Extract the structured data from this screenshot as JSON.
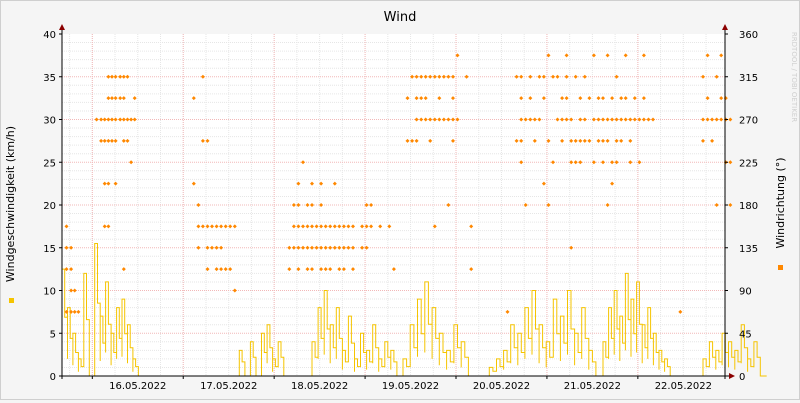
{
  "chart_data": {
    "type": "scatter",
    "title": "Wind",
    "watermark": "RRDTOOL / TOBI OETIKER",
    "ylabel_left": "Windgeschwindigkeit (km/h)",
    "ylabel_right": "Windrichtung (°)",
    "y_left_range": [
      0,
      40
    ],
    "y_right_range": [
      0,
      360
    ],
    "y_left_ticks": [
      "0",
      "5",
      "10",
      "15",
      "20",
      "25",
      "30",
      "35",
      "40"
    ],
    "y_right_ticks": [
      "0",
      "45",
      "90",
      "135",
      "180",
      "225",
      "270",
      "315",
      "360"
    ],
    "x_range": [
      "15.05.2022 16:00",
      "22.05.2022 23:00"
    ],
    "x_ticks": [
      "16.05.2022",
      "17.05.2022",
      "18.05.2022",
      "19.05.2022",
      "20.05.2022",
      "21.05.2022",
      "22.05.2022"
    ],
    "grid": true,
    "colors": {
      "speed": "#f5c400",
      "direction": "#ff8800",
      "grid_major": "#f2b8b8",
      "grid_minor": "#e6e6e6",
      "axis": "#8b0000"
    },
    "series": [
      {
        "name": "",
        "axis": "left",
        "kind": "step-line",
        "segments": [
          {
            "start_day": 0.0,
            "end_day": 0.9,
            "peaks": [
              12.5,
              8,
              5,
              2,
              12,
              0,
              15.5,
              7,
              11,
              5,
              8,
              9,
              6,
              2,
              0
            ]
          },
          {
            "start_day": 1.95,
            "end_day": 2.5,
            "peaks": [
              3,
              0,
              4,
              0,
              5,
              6,
              2,
              4,
              0
            ]
          },
          {
            "start_day": 2.75,
            "end_day": 3.75,
            "peaks": [
              4,
              8,
              10,
              6,
              8,
              3,
              7,
              2,
              5,
              3,
              6,
              2,
              4,
              3,
              0
            ]
          },
          {
            "start_day": 3.75,
            "end_day": 4.55,
            "peaks": [
              2,
              6,
              9,
              11,
              8,
              5,
              3,
              6,
              4,
              0
            ]
          },
          {
            "start_day": 4.7,
            "end_day": 5.95,
            "peaks": [
              1,
              2,
              3,
              6,
              5,
              8,
              10,
              6,
              4,
              9,
              7,
              10,
              5,
              8,
              3,
              0
            ]
          },
          {
            "start_day": 5.95,
            "end_day": 6.75,
            "peaks": [
              4,
              8,
              10,
              7,
              12,
              9,
              11,
              6,
              8,
              5,
              3,
              2,
              0
            ]
          },
          {
            "start_day": 7.05,
            "end_day": 7.75,
            "peaks": [
              2,
              4,
              3,
              5,
              4,
              3,
              6,
              2,
              4,
              0
            ]
          }
        ]
      },
      {
        "name": "",
        "axis": "right",
        "kind": "points",
        "columns": [
          [
            0.05,
            [
              67.5,
              112.5,
              135,
              157.5
            ]
          ],
          [
            0.1,
            [
              67.5,
              90,
              112.5,
              135
            ]
          ],
          [
            0.14,
            [
              67.5,
              90
            ]
          ],
          [
            0.18,
            [
              67.5
            ]
          ],
          [
            0.38,
            [
              270
            ]
          ],
          [
            0.43,
            [
              247.5,
              270
            ]
          ],
          [
            0.47,
            [
              157.5,
              202.5,
              247.5,
              270
            ]
          ],
          [
            0.51,
            [
              157.5,
              202.5,
              247.5,
              270,
              292.5,
              315
            ]
          ],
          [
            0.55,
            [
              247.5,
              270,
              292.5,
              315
            ]
          ],
          [
            0.59,
            [
              202.5,
              247.5,
              270,
              292.5,
              315
            ]
          ],
          [
            0.64,
            [
              270,
              292.5,
              315
            ]
          ],
          [
            0.68,
            [
              112.5,
              247.5,
              270,
              292.5,
              315
            ]
          ],
          [
            0.72,
            [
              247.5,
              270,
              315
            ]
          ],
          [
            0.76,
            [
              225,
              270
            ]
          ],
          [
            0.8,
            [
              270,
              292.5
            ]
          ],
          [
            1.45,
            [
              202.5,
              292.5
            ]
          ],
          [
            1.5,
            [
              135,
              157.5,
              180
            ]
          ],
          [
            1.55,
            [
              157.5,
              247.5,
              315
            ]
          ],
          [
            1.6,
            [
              112.5,
              135,
              157.5,
              247.5
            ]
          ],
          [
            1.65,
            [
              135,
              157.5
            ]
          ],
          [
            1.7,
            [
              112.5,
              135,
              157.5
            ]
          ],
          [
            1.75,
            [
              112.5,
              135,
              157.5
            ]
          ],
          [
            1.8,
            [
              112.5,
              157.5
            ]
          ],
          [
            1.85,
            [
              112.5,
              157.5
            ]
          ],
          [
            1.9,
            [
              90,
              157.5
            ]
          ],
          [
            2.5,
            [
              112.5,
              135
            ]
          ],
          [
            2.55,
            [
              135,
              157.5,
              180
            ]
          ],
          [
            2.6,
            [
              112.5,
              135,
              157.5,
              180,
              202.5
            ]
          ],
          [
            2.65,
            [
              135,
              157.5,
              225
            ]
          ],
          [
            2.7,
            [
              112.5,
              135,
              157.5,
              180
            ]
          ],
          [
            2.75,
            [
              112.5,
              135,
              157.5,
              180,
              202.5
            ]
          ],
          [
            2.8,
            [
              135,
              157.5
            ]
          ],
          [
            2.85,
            [
              112.5,
              135,
              157.5,
              180,
              202.5
            ]
          ],
          [
            2.9,
            [
              112.5,
              135,
              157.5
            ]
          ],
          [
            2.95,
            [
              112.5,
              135,
              157.5
            ]
          ],
          [
            3.0,
            [
              135,
              157.5,
              202.5
            ]
          ],
          [
            3.05,
            [
              112.5,
              135,
              157.5
            ]
          ],
          [
            3.1,
            [
              112.5,
              135,
              157.5
            ]
          ],
          [
            3.15,
            [
              135,
              157.5
            ]
          ],
          [
            3.2,
            [
              112.5,
              135,
              157.5
            ]
          ],
          [
            3.3,
            [
              135,
              157.5
            ]
          ],
          [
            3.35,
            [
              135,
              157.5,
              180
            ]
          ],
          [
            3.4,
            [
              157.5,
              180
            ]
          ],
          [
            3.5,
            [
              157.5
            ]
          ],
          [
            3.6,
            [
              157.5
            ]
          ],
          [
            3.65,
            [
              112.5
            ]
          ],
          [
            3.8,
            [
              247.5,
              292.5
            ]
          ],
          [
            3.85,
            [
              247.5,
              315
            ]
          ],
          [
            3.9,
            [
              247.5,
              270,
              292.5,
              315
            ]
          ],
          [
            3.95,
            [
              270,
              292.5,
              315
            ]
          ],
          [
            4.0,
            [
              270,
              292.5,
              315
            ]
          ],
          [
            4.05,
            [
              247.5,
              270,
              315
            ]
          ],
          [
            4.1,
            [
              157.5,
              270,
              315
            ]
          ],
          [
            4.15,
            [
              270,
              292.5,
              315
            ]
          ],
          [
            4.2,
            [
              270,
              315
            ]
          ],
          [
            4.25,
            [
              180,
              270,
              315
            ]
          ],
          [
            4.3,
            [
              247.5,
              270,
              292.5,
              315
            ]
          ],
          [
            4.35,
            [
              270,
              337.5
            ]
          ],
          [
            4.45,
            [
              315
            ]
          ],
          [
            4.5,
            [
              112.5,
              157.5
            ]
          ],
          [
            4.9,
            [
              67.5
            ]
          ],
          [
            5.0,
            [
              247.5,
              315
            ]
          ],
          [
            5.05,
            [
              225,
              247.5,
              270,
              292.5,
              315
            ]
          ],
          [
            5.1,
            [
              180,
              270
            ]
          ],
          [
            5.15,
            [
              270,
              292.5,
              315
            ]
          ],
          [
            5.2,
            [
              247.5,
              270
            ]
          ],
          [
            5.25,
            [
              270,
              315
            ]
          ],
          [
            5.3,
            [
              202.5,
              292.5,
              315
            ]
          ],
          [
            5.35,
            [
              180,
              247.5,
              337.5
            ]
          ],
          [
            5.4,
            [
              225,
              315
            ]
          ],
          [
            5.45,
            [
              270,
              315
            ]
          ],
          [
            5.5,
            [
              247.5,
              270,
              292.5
            ]
          ],
          [
            5.55,
            [
              270,
              292.5,
              315,
              337.5
            ]
          ],
          [
            5.6,
            [
              135,
              225,
              247.5,
              270
            ]
          ],
          [
            5.65,
            [
              225,
              247.5,
              315
            ]
          ],
          [
            5.7,
            [
              225,
              247.5,
              270,
              292.5
            ]
          ],
          [
            5.75,
            [
              247.5,
              270,
              315
            ]
          ],
          [
            5.8,
            [
              247.5,
              292.5
            ]
          ],
          [
            5.85,
            [
              225,
              270,
              337.5
            ]
          ],
          [
            5.9,
            [
              247.5,
              270,
              292.5
            ]
          ],
          [
            5.95,
            [
              225,
              247.5,
              270,
              292.5
            ]
          ],
          [
            6.0,
            [
              180,
              247.5,
              270,
              337.5
            ]
          ],
          [
            6.05,
            [
              202.5,
              225,
              270,
              292.5
            ]
          ],
          [
            6.1,
            [
              225,
              247.5,
              270,
              315
            ]
          ],
          [
            6.15,
            [
              247.5,
              270,
              292.5
            ]
          ],
          [
            6.2,
            [
              270,
              292.5,
              337.5
            ]
          ],
          [
            6.25,
            [
              225,
              247.5,
              270
            ]
          ],
          [
            6.3,
            [
              270,
              292.5
            ]
          ],
          [
            6.35,
            [
              225,
              270
            ]
          ],
          [
            6.4,
            [
              270,
              292.5,
              337.5
            ]
          ],
          [
            6.45,
            [
              270
            ]
          ],
          [
            6.5,
            [
              270
            ]
          ],
          [
            6.8,
            [
              67.5
            ]
          ],
          [
            7.05,
            [
              247.5,
              270,
              315
            ]
          ],
          [
            7.1,
            [
              270,
              292.5,
              337.5
            ]
          ],
          [
            7.15,
            [
              247.5,
              270
            ]
          ],
          [
            7.2,
            [
              180,
              270,
              315
            ]
          ],
          [
            7.25,
            [
              270,
              292.5,
              337.5
            ]
          ],
          [
            7.3,
            [
              225,
              270,
              292.5
            ]
          ],
          [
            7.35,
            [
              180,
              225,
              270
            ]
          ]
        ]
      }
    ]
  }
}
